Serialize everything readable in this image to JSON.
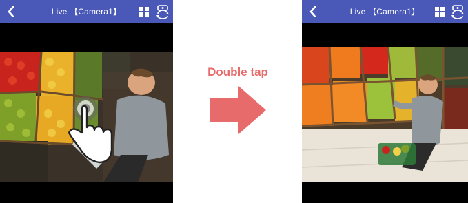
{
  "left_screen": {
    "title": "Live 【Camera1】",
    "icons": [
      "back-arrow-icon",
      "grid-layout-icon",
      "camera-switch-icon"
    ]
  },
  "right_screen": {
    "title": "Live 【Camera1】",
    "icons": [
      "back-arrow-icon",
      "grid-layout-icon",
      "camera-switch-icon"
    ]
  },
  "gesture": {
    "label": "Double tap",
    "color": "#e86b6b"
  },
  "colors": {
    "topbar": "#4a59b8",
    "background": "#000000"
  }
}
